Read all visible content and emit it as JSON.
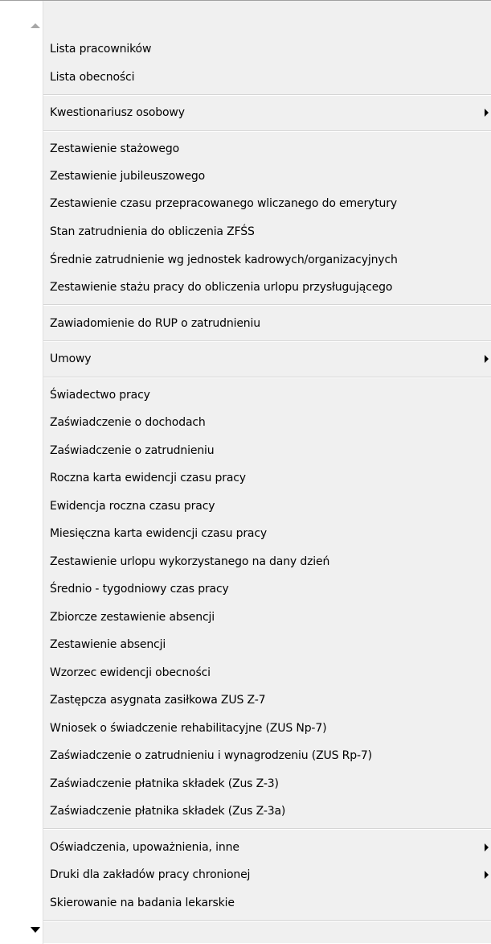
{
  "menu": {
    "scroll_up_icon": "triangle-up-icon",
    "scroll_down_icon": "triangle-down-icon",
    "submenu_icon": "triangle-right-icon",
    "items": [
      {
        "label": "Lista pracowników",
        "submenu": false
      },
      {
        "label": "Lista obecności",
        "submenu": false
      },
      {
        "label": "Kwestionariusz osobowy",
        "submenu": true
      },
      {
        "label": "Zestawienie stażowego",
        "submenu": false
      },
      {
        "label": "Zestawienie jubileuszowego",
        "submenu": false
      },
      {
        "label": "Zestawienie czasu przepracowanego wliczanego do emerytury",
        "submenu": false
      },
      {
        "label": "Stan zatrudnienia do obliczenia ZFŚS",
        "submenu": false
      },
      {
        "label": "Średnie zatrudnienie wg jednostek kadrowych/organizacyjnych",
        "submenu": false
      },
      {
        "label": "Zestawienie stażu pracy do obliczenia urlopu przysługującego",
        "submenu": false
      },
      {
        "label": "Zawiadomienie do RUP o zatrudnieniu",
        "submenu": false
      },
      {
        "label": "Umowy",
        "submenu": true
      },
      {
        "label": "Świadectwo pracy",
        "submenu": false
      },
      {
        "label": "Zaświadczenie o dochodach",
        "submenu": false
      },
      {
        "label": "Zaświadczenie o zatrudnieniu",
        "submenu": false
      },
      {
        "label": "Roczna karta ewidencji czasu pracy",
        "submenu": false
      },
      {
        "label": "Ewidencja roczna czasu pracy",
        "submenu": false
      },
      {
        "label": "Miesięczna karta ewidencji czasu pracy",
        "submenu": false
      },
      {
        "label": "Zestawienie urlopu wykorzystanego na dany dzień",
        "submenu": false
      },
      {
        "label": "Średnio - tygodniowy czas pracy",
        "submenu": false
      },
      {
        "label": "Zbiorcze zestawienie absencji",
        "submenu": false
      },
      {
        "label": "Zestawienie absencji",
        "submenu": false
      },
      {
        "label": "Wzorzec ewidencji obecności",
        "submenu": false
      },
      {
        "label": "Zastępcza asygnata zasiłkowa ZUS Z-7",
        "submenu": false
      },
      {
        "label": "Wniosek o świadczenie rehabilitacyjne (ZUS Np-7)",
        "submenu": false
      },
      {
        "label": "Zaświadczenie o zatrudnieniu i wynagrodzeniu (ZUS Rp-7)",
        "submenu": false
      },
      {
        "label": "Zaświadczenie płatnika składek (Zus Z-3)",
        "submenu": false
      },
      {
        "label": "Zaświadczenie płatnika składek (Zus Z-3a)",
        "submenu": false
      },
      {
        "label": "Oświadczenia, upoważnienia, inne",
        "submenu": true
      },
      {
        "label": "Druki dla zakładów pracy chronionej",
        "submenu": true
      },
      {
        "label": "Skierowanie na badania lekarskie",
        "submenu": false
      }
    ]
  }
}
